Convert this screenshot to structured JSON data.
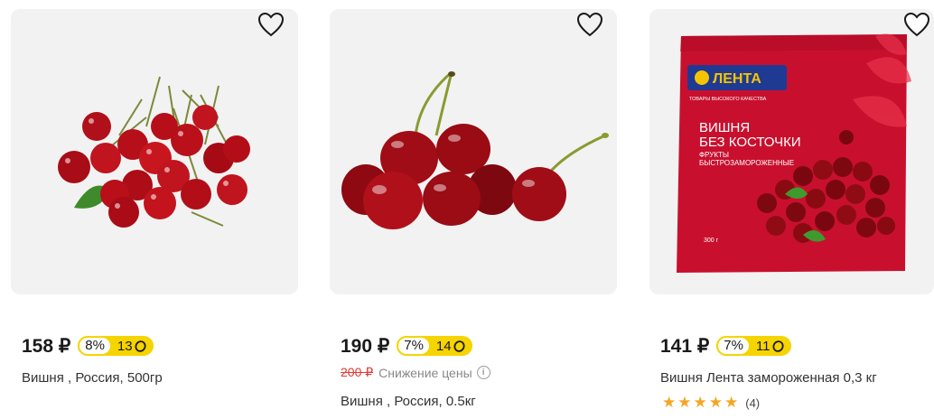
{
  "currency": "₽",
  "products": [
    {
      "price": "158 ₽",
      "bonus_percent": "8%",
      "bonus_points": "13",
      "name": "Вишня , Россия, 500гр"
    },
    {
      "price": "190 ₽",
      "bonus_percent": "7%",
      "bonus_points": "14",
      "old_price": "200 ₽",
      "discount_text": "Снижение цены",
      "name": "Вишня , Россия, 0.5кг"
    },
    {
      "price": "141 ₽",
      "bonus_percent": "7%",
      "bonus_points": "11",
      "name": "Вишня Лента замороженная 0,3 кг",
      "rating_count": "(4)",
      "rating": 5,
      "package": {
        "brand": "ЛЕНТА",
        "tagline": "ТОВАРЫ ВЫСОКОГО КАЧЕСТВА",
        "title_line1": "ВИШНЯ",
        "title_line2": "БЕЗ КОСТОЧКИ",
        "subtitle_line1": "ФРУКТЫ",
        "subtitle_line2": "БЫСТРОЗАМОРОЖЕННЫЕ",
        "weight": "300 г"
      }
    }
  ],
  "colors": {
    "bonus_yellow": "#f5d400",
    "old_price_red": "#e53935",
    "star": "#f5a623",
    "card_bg": "#f2f2f2",
    "package_red": "#c8102e"
  }
}
